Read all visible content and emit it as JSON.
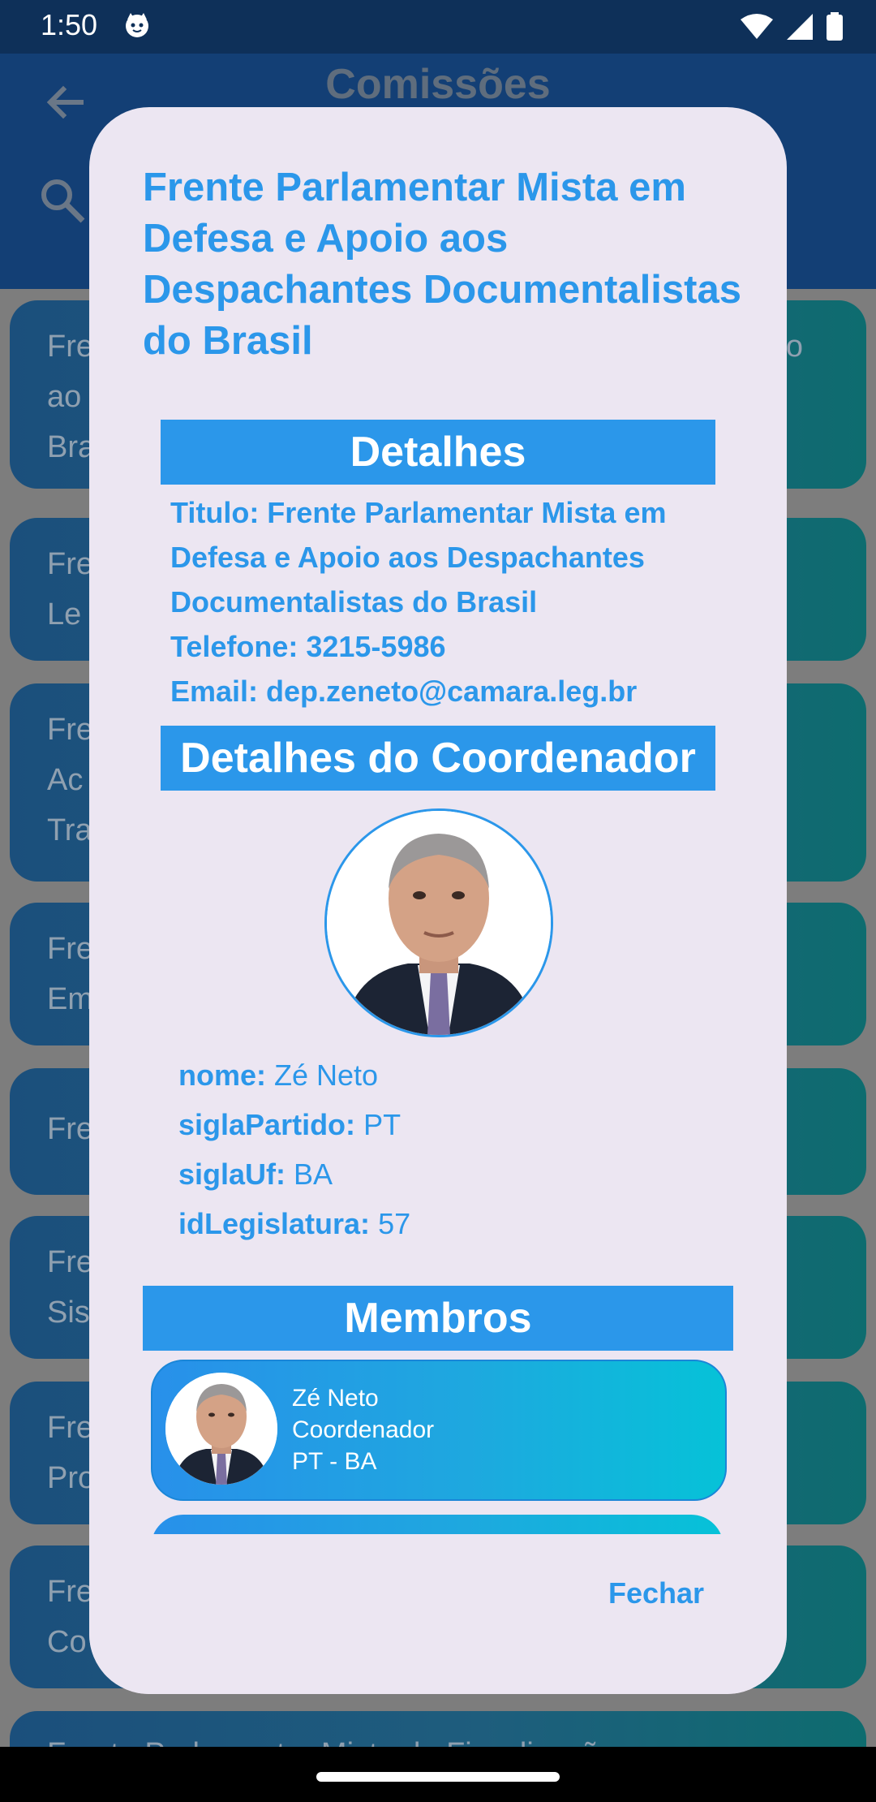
{
  "status_bar": {
    "time": "1:50"
  },
  "app_bar": {
    "title": "Comissões"
  },
  "list_items": [
    {
      "text": "Fre\nao\nBra",
      "right": "o"
    },
    {
      "text": "Fre\nLe",
      "right": ""
    },
    {
      "text": "Fre\nAc\nTra",
      "right": ""
    },
    {
      "text": "Fre\nEm",
      "right": ""
    },
    {
      "text": "Fre",
      "right": ""
    },
    {
      "text": "Fre\nSis",
      "right": ""
    },
    {
      "text": "Fre\nPro",
      "right": ""
    },
    {
      "text": "Fre\nCo",
      "right": ""
    },
    {
      "text": "Frente Parlamentar Mista de Fiscalização",
      "right": ""
    }
  ],
  "dialog": {
    "title": "Frente Parlamentar Mista em Defesa e Apoio aos Despachantes Documentalistas do Brasil",
    "details_header": "Detalhes",
    "details": {
      "titulo": "Titulo: Frente Parlamentar Mista em Defesa e Apoio aos Despachantes Documentalistas do Brasil",
      "telefone": "Telefone: 3215-5986",
      "email": "Email: dep.zeneto@camara.leg.br"
    },
    "coordinator_header": "Detalhes do Coordenador",
    "coordinator": {
      "nome_label": "nome:",
      "nome_value": "Zé Neto",
      "partido_label": "siglaPartido:",
      "partido_value": "PT",
      "uf_label": "siglaUf:",
      "uf_value": "BA",
      "legislatura_label": "idLegislatura:",
      "legislatura_value": "57"
    },
    "members_header": "Membros",
    "members": [
      {
        "name": "Zé Neto",
        "role": "Coordenador",
        "party_uf": "PT - BA"
      }
    ],
    "close_label": "Fechar"
  },
  "colors": {
    "accent": "#2b97ea",
    "dialog_bg": "#ece6f2",
    "status_bar": "#0e3059",
    "app_bar": "#133f75"
  }
}
